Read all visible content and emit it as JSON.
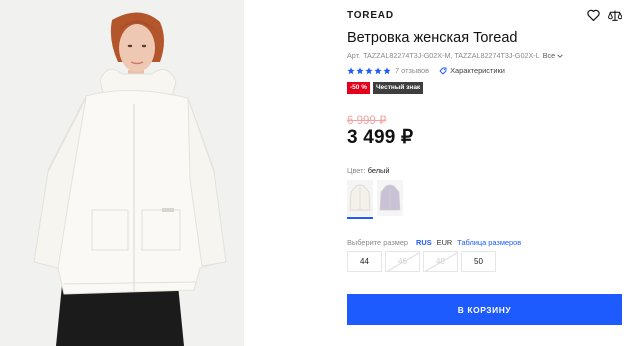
{
  "product": {
    "brand": "TOREAD",
    "title": "Ветровка женская Toread",
    "article_prefix": "Арт.",
    "article_codes": "TAZZAL82274T3J-G02X-M, TAZZAL82274T3J-G02X-L",
    "article_all": "Все",
    "rating_stars": 5,
    "reviews": "7 отзывов",
    "characteristics": "Характеристики",
    "badges": {
      "sale": "-50 %",
      "honest": "Честный знак"
    },
    "old_price": "6 999 ₽",
    "price": "3 499 ₽",
    "color_label": "Цвет:",
    "color_value": "белый",
    "swatches": [
      {
        "name": "white",
        "color": "#f3f1ea",
        "selected": true
      },
      {
        "name": "lavender",
        "color": "#c9c2d6",
        "selected": false
      }
    ],
    "size_label": "Выберите размер",
    "size_systems": [
      "RUS",
      "EUR"
    ],
    "size_system_active": "RUS",
    "size_table": "Таблица размеров",
    "sizes": [
      {
        "label": "44",
        "available": true
      },
      {
        "label": "46",
        "available": false
      },
      {
        "label": "48",
        "available": false
      },
      {
        "label": "50",
        "available": true
      }
    ],
    "cart_button": "В КОРЗИНУ"
  },
  "icons": {
    "favorite": "heart-icon",
    "compare": "scales-icon",
    "characteristics": "tag-icon",
    "dropdown": "chevron-down-icon"
  },
  "colors": {
    "accent": "#1e5bff",
    "sale": "#e4001c",
    "honest_badge": "#3e3e3e",
    "old_price": "#f0a3a3",
    "stars": "#1e5bff"
  }
}
